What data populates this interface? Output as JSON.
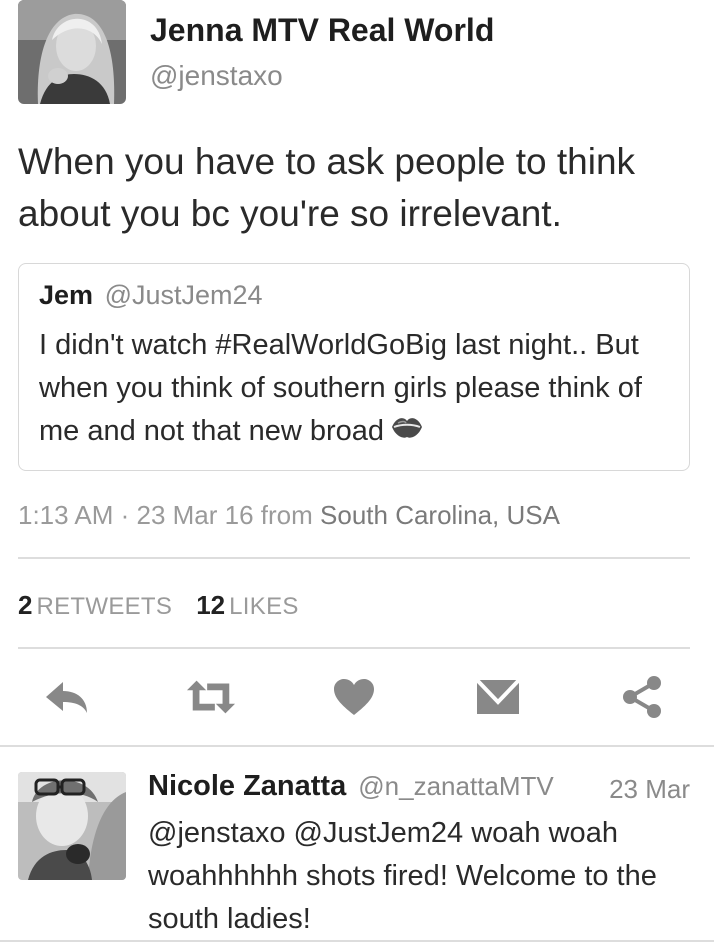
{
  "tweet": {
    "author_name": "Jenna MTV Real World",
    "author_handle": "@jenstaxo",
    "text": "When you have to ask people to think about you bc you're so irrelevant.",
    "timestamp": "1:13 AM · 23 Mar 16",
    "from_label": "from",
    "location": "South Carolina, USA"
  },
  "quoted_tweet": {
    "author_name": "Jem",
    "author_handle": "@JustJem24",
    "text": "I didn't watch #RealWorldGoBig last night.. But when you think of southern girls please think of me and not that new broad",
    "emoji": "kiss-mark-icon"
  },
  "stats": {
    "retweets_count": "2",
    "retweets_label": "RETWEETS",
    "likes_count": "12",
    "likes_label": "LIKES"
  },
  "actions": [
    {
      "name": "reply",
      "icon": "reply-icon"
    },
    {
      "name": "retweet",
      "icon": "retweet-icon"
    },
    {
      "name": "like",
      "icon": "heart-icon"
    },
    {
      "name": "message",
      "icon": "envelope-icon"
    },
    {
      "name": "share",
      "icon": "share-icon"
    }
  ],
  "reply": {
    "author_name": "Nicole Zanatta",
    "author_handle": "@n_zanattaMTV",
    "date": "23 Mar",
    "text": "@jenstaxo @JustJem24 woah woah woahhhhhh shots fired! Welcome to the south ladies!"
  },
  "colors": {
    "text": "#222222",
    "muted": "#8a8a8a",
    "divider": "#dddddd",
    "icon": "#888888"
  }
}
